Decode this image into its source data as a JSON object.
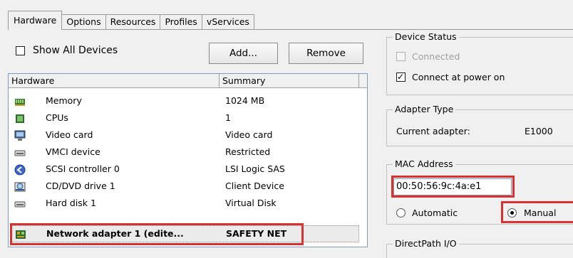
{
  "tabs": [
    {
      "label": "Hardware",
      "active": true
    },
    {
      "label": "Options"
    },
    {
      "label": "Resources"
    },
    {
      "label": "Profiles"
    },
    {
      "label": "vServices"
    }
  ],
  "toolbar": {
    "show_all_label": "Show All Devices",
    "show_all_checked": false,
    "add_label": "Add...",
    "remove_label": "Remove"
  },
  "hardware_table": {
    "col_hardware": "Hardware",
    "col_summary": "Summary",
    "rows": [
      {
        "name": "Memory",
        "summary": "1024 MB",
        "icon": "memory-icon"
      },
      {
        "name": "CPUs",
        "summary": "1",
        "icon": "cpu-icon"
      },
      {
        "name": "Video card",
        "summary": "Video card",
        "icon": "monitor-icon"
      },
      {
        "name": "VMCI device",
        "summary": "Restricted",
        "icon": "device-icon"
      },
      {
        "name": "SCSI controller 0",
        "summary": "LSI Logic SAS",
        "icon": "scsi-controller-icon"
      },
      {
        "name": "CD/DVD drive 1",
        "summary": "Client Device",
        "icon": "cd-drive-icon"
      },
      {
        "name": "Hard disk 1",
        "summary": "Virtual Disk",
        "icon": "hard-disk-icon"
      },
      {
        "name": "Network adapter 1 (edite...",
        "summary": "SAFETY NET",
        "icon": "network-adapter-icon",
        "selected": true
      }
    ]
  },
  "device_status": {
    "legend": "Device Status",
    "connected_label": "Connected",
    "connected_checked": false,
    "connect_power_label": "Connect at power on",
    "connect_power_checked": true
  },
  "adapter_type": {
    "legend": "Adapter Type",
    "current_label": "Current adapter:",
    "current_value": "E1000"
  },
  "mac_address": {
    "legend": "MAC Address",
    "value": "00:50:56:9c:4a:e1",
    "automatic_label": "Automatic",
    "manual_label": "Manual",
    "selected": "Manual"
  },
  "directpath": {
    "legend": "DirectPath I/O"
  },
  "colors": {
    "highlight_box": "#d9312f",
    "window_bg": "#f0f0f0"
  }
}
